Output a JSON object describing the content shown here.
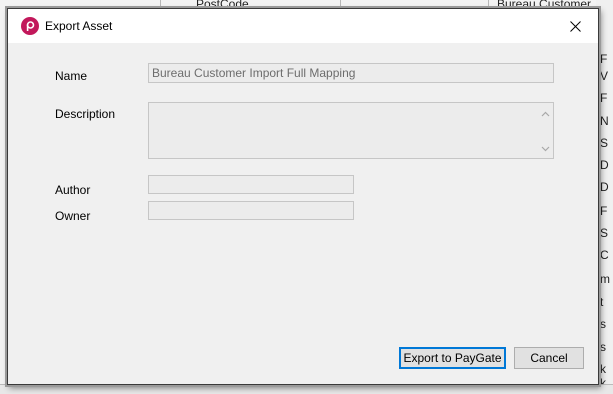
{
  "background": {
    "column_texts": [
      "PostCode",
      "Bureau Customer"
    ],
    "right_letters": [
      "F",
      "V",
      "F",
      "N",
      "S",
      "D",
      "D",
      "F",
      "S",
      "C",
      "m",
      "t",
      "s",
      "s",
      "k",
      "k"
    ]
  },
  "dialog": {
    "title": "Export Asset",
    "brand_color": "#c2185b",
    "fields": {
      "name_label": "Name",
      "name_value": "Bureau Customer Import Full Mapping",
      "description_label": "Description",
      "description_value": "",
      "author_label": "Author",
      "author_value": "",
      "owner_label": "Owner",
      "owner_value": ""
    },
    "buttons": {
      "export_label": "Export to PayGate",
      "cancel_label": "Cancel"
    },
    "icons": {
      "app": "paygate-logo-icon",
      "close": "close-icon"
    }
  }
}
